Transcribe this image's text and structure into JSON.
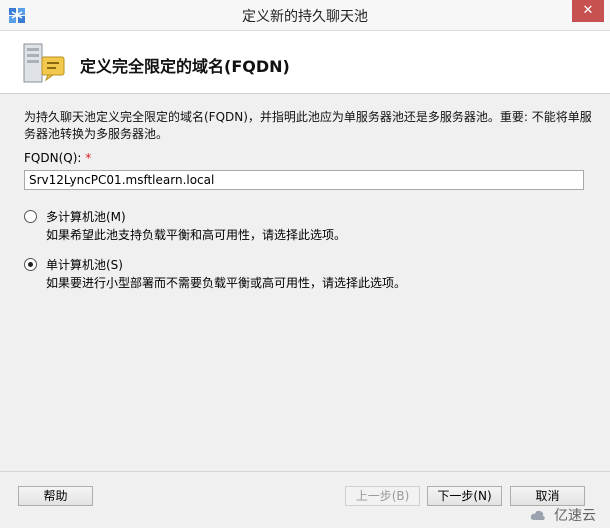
{
  "window": {
    "title": "定义新的持久聊天池",
    "close_glyph": "✕"
  },
  "header": {
    "title": "定义完全限定的域名(FQDN)"
  },
  "content": {
    "description": "为持久聊天池定义完全限定的域名(FQDN)，并指明此池应为单服务器池还是多服务器池。重要: 不能将单服务器池转换为多服务器池。",
    "fqdn_label": "FQDN(Q):",
    "required_mark": "*",
    "fqdn_value": "Srv12LyncPC01.msftlearn.local",
    "options": [
      {
        "label": "多计算机池(M)",
        "description": "如果希望此池支持负载平衡和高可用性，请选择此选项。",
        "selected": false
      },
      {
        "label": "单计算机池(S)",
        "description": "如果要进行小型部署而不需要负载平衡或高可用性，请选择此选项。",
        "selected": true
      }
    ]
  },
  "buttons": {
    "help": "帮助",
    "back": "上一步(B)",
    "next": "下一步(N)",
    "cancel": "取消"
  },
  "watermark": {
    "text": "亿速云"
  },
  "colors": {
    "close_button": "#c75050",
    "required": "#e02020"
  }
}
